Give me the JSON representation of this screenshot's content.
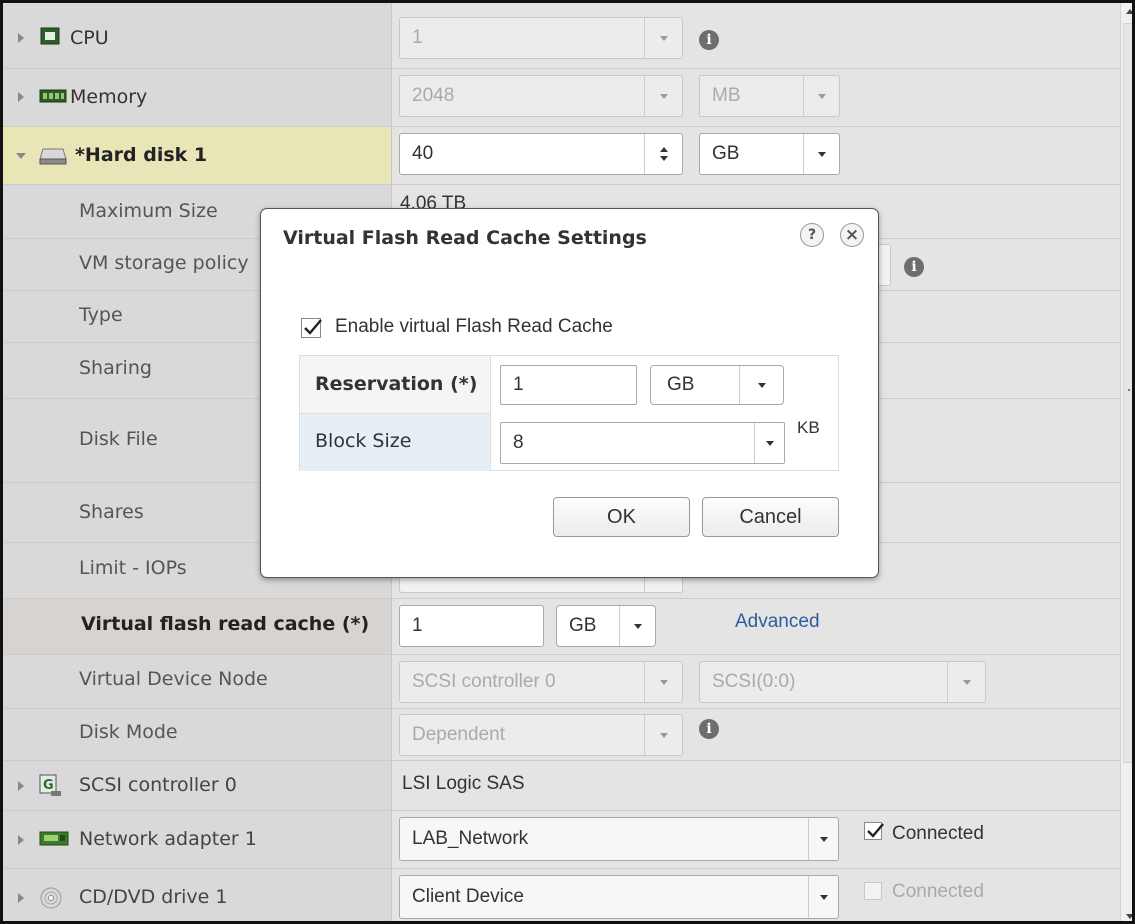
{
  "devices": {
    "cpu": {
      "label": "CPU",
      "value": "1"
    },
    "memory": {
      "label": "Memory",
      "value": "2048",
      "unit": "MB"
    },
    "hard_disk": {
      "label": "*Hard disk 1",
      "value": "40",
      "unit": "GB"
    },
    "scsi": {
      "label": "SCSI controller 0",
      "value": "LSI Logic SAS"
    },
    "network": {
      "label": "Network adapter 1",
      "value": "LAB_Network",
      "connected_label": "Connected",
      "connected": true
    },
    "cdvd": {
      "label": "CD/DVD drive 1",
      "value": "Client Device",
      "connected_label": "Connected",
      "connected": false
    }
  },
  "hard_disk_details": {
    "max_size": {
      "label": "Maximum Size",
      "value": "4.06 TB"
    },
    "storage_policy": {
      "label": "VM storage policy"
    },
    "type": {
      "label": "Type"
    },
    "sharing": {
      "label": "Sharing"
    },
    "disk_file": {
      "label": "Disk File"
    },
    "shares": {
      "label": "Shares"
    },
    "limit_iops": {
      "label": "Limit - IOPs"
    },
    "vfrc": {
      "label": "Virtual flash read cache (*)",
      "value": "1",
      "unit": "GB",
      "advanced_link": "Advanced"
    },
    "device_node": {
      "label": "Virtual Device Node",
      "controller": "SCSI controller 0",
      "node": "SCSI(0:0)"
    },
    "disk_mode": {
      "label": "Disk Mode",
      "value": "Dependent"
    }
  },
  "modal": {
    "title": "Virtual Flash Read Cache Settings",
    "help_glyph": "?",
    "close_glyph": "×",
    "enable_label": "Enable virtual Flash Read Cache",
    "enable_checked": true,
    "reservation_label": "Reservation (*)",
    "reservation_value": "1",
    "reservation_unit": "GB",
    "block_size_label": "Block Size",
    "block_size_value": "8",
    "block_size_unit": "KB",
    "ok_label": "OK",
    "cancel_label": "Cancel"
  },
  "icons": {
    "info": "i"
  }
}
